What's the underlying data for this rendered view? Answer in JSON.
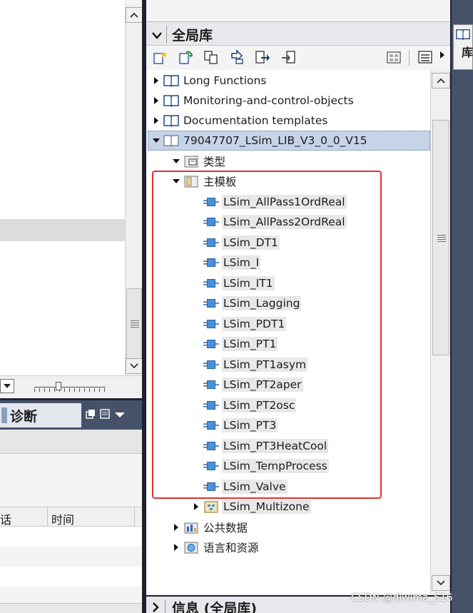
{
  "library": {
    "title": "全局库",
    "items": [
      {
        "label": "Long Functions",
        "expanded": false,
        "type": "library"
      },
      {
        "label": "Monitoring-and-control-objects",
        "expanded": false,
        "type": "library"
      },
      {
        "label": "Documentation templates",
        "expanded": false,
        "type": "library"
      },
      {
        "label": "79047707_LSim_LIB_V3_0_0_V15",
        "expanded": true,
        "type": "library",
        "selected": true
      }
    ],
    "types_folder": "类型",
    "master_folder": "主模板",
    "master_items": [
      "LSim_AllPass1OrdReal",
      "LSim_AllPass2OrdReal",
      "LSim_DT1",
      "LSim_I",
      "LSim_IT1",
      "LSim_Lagging",
      "LSim_PDT1",
      "LSim_PT1",
      "LSim_PT1asym",
      "LSim_PT2aper",
      "LSim_PT2osc",
      "LSim_PT3",
      "LSim_PT3HeatCool",
      "LSim_TempProcess",
      "LSim_Valve"
    ],
    "multizone": "LSim_Multizone",
    "common_data": "公共数据",
    "languages": "语言和资源"
  },
  "info_panel": {
    "title": "信息 (全局库)"
  },
  "side_tab": {
    "label": "库"
  },
  "diagnostics": {
    "tab_label": "诊断",
    "col_left": "话",
    "col_time": "时间"
  },
  "watermark": "CSDN @dlwlma_516",
  "colors": {
    "accent_dark": "#46526a",
    "selection": "#c6d4e8",
    "highlight_frame": "#e53030"
  }
}
